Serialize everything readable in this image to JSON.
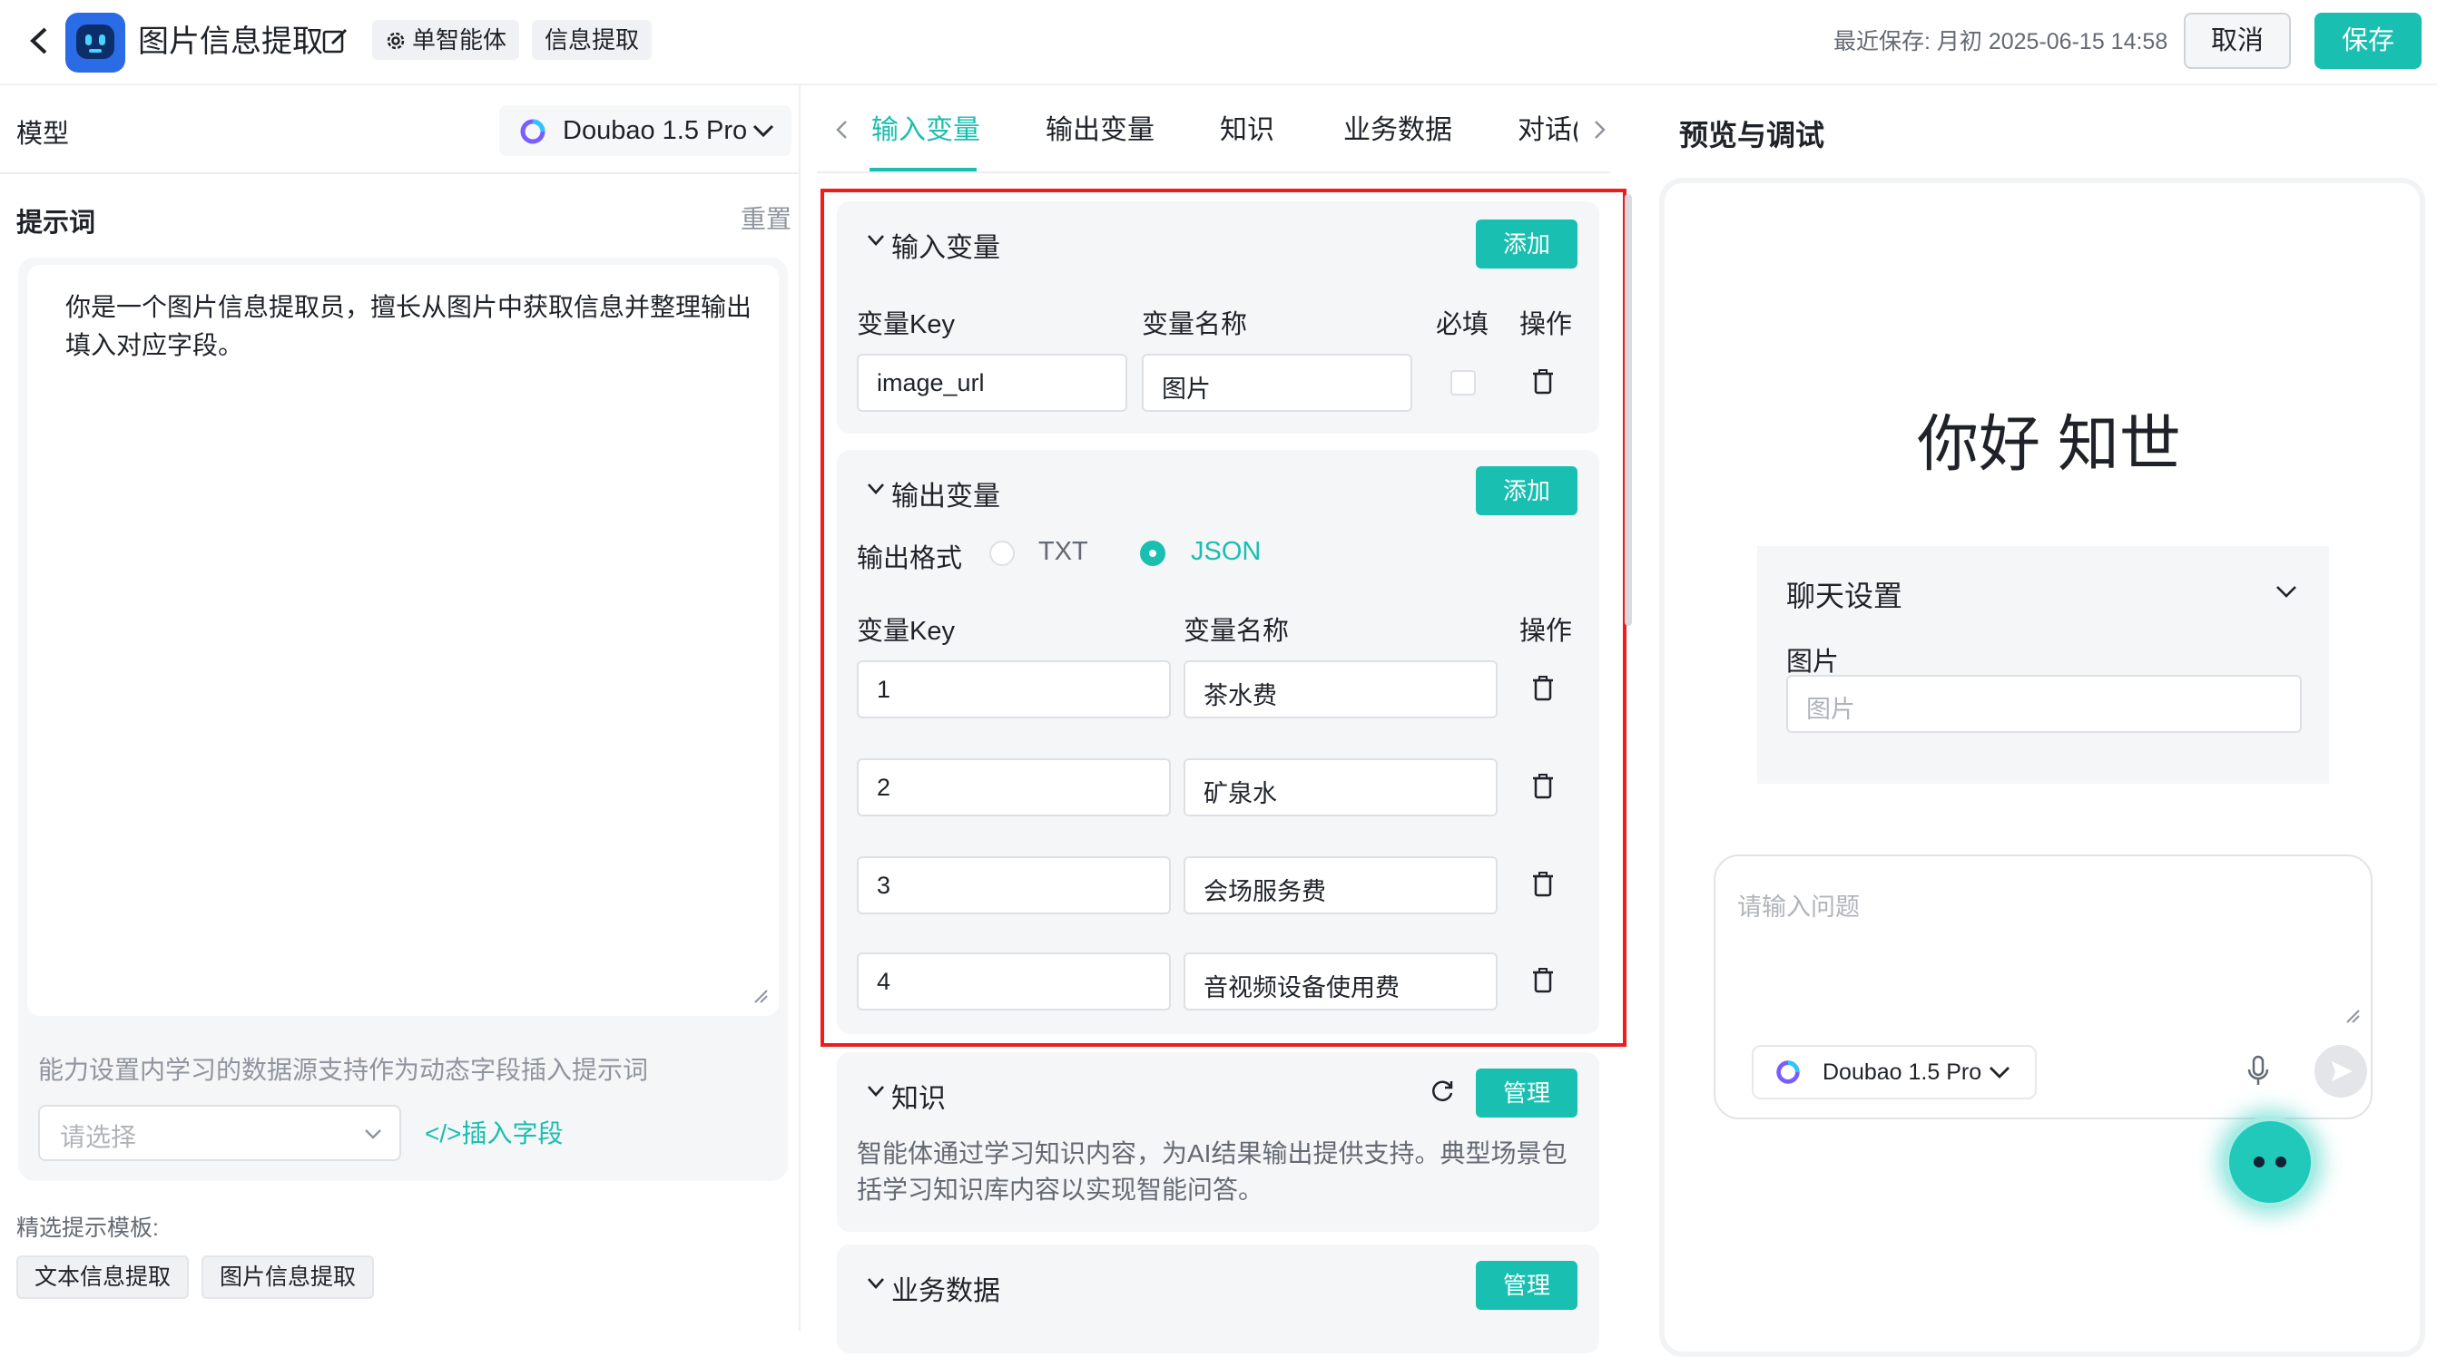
{
  "header": {
    "title": "图片信息提取",
    "tags": [
      "单智能体",
      "信息提取"
    ],
    "last_saved": "最近保存: 月初 2025-06-15 14:58",
    "cancel_label": "取消",
    "save_label": "保存"
  },
  "left": {
    "model_label": "模型",
    "model_name": "Doubao 1.5 Pro",
    "prompt_label": "提示词",
    "reset_label": "重置",
    "prompt_text": "你是一个图片信息提取员，擅长从图片中获取信息并整理输出填入对应字段。",
    "helper_text": "能力设置内学习的数据源支持作为动态字段插入提示词",
    "select_placeholder": "请选择",
    "insert_field_label": "</>插入字段",
    "template_label": "精选提示模板:",
    "templates": [
      "文本信息提取",
      "图片信息提取"
    ]
  },
  "tabs": [
    "输入变量",
    "输出变量",
    "知识",
    "业务数据",
    "对话("
  ],
  "input_vars": {
    "title": "输入变量",
    "add_label": "添加",
    "columns": [
      "变量Key",
      "变量名称",
      "必填",
      "操作"
    ],
    "rows": [
      {
        "key": "image_url",
        "name": "图片",
        "required": false
      }
    ]
  },
  "output_vars": {
    "title": "输出变量",
    "add_label": "添加",
    "format_label": "输出格式",
    "formats": [
      {
        "label": "TXT",
        "selected": false
      },
      {
        "label": "JSON",
        "selected": true
      }
    ],
    "columns": [
      "变量Key",
      "变量名称",
      "操作"
    ],
    "rows": [
      {
        "key": "1",
        "name": "茶水费"
      },
      {
        "key": "2",
        "name": "矿泉水"
      },
      {
        "key": "3",
        "name": "会场服务费"
      },
      {
        "key": "4",
        "name": "音视频设备使用费"
      }
    ]
  },
  "knowledge": {
    "title": "知识",
    "manage_label": "管理",
    "description": "智能体通过学习知识内容，为AI结果输出提供支持。典型场景包括学习知识库内容以实现智能问答。"
  },
  "business_data": {
    "title": "业务数据",
    "manage_label": "管理"
  },
  "preview": {
    "title": "预览与调试",
    "greeting": "你好 知世",
    "chat_settings_title": "聊天设置",
    "image_label": "图片",
    "image_placeholder": "图片",
    "question_placeholder": "请输入问题",
    "model_name": "Doubao 1.5 Pro"
  },
  "colors": {
    "accent": "#19bfb0",
    "highlight": "#ee1c1c"
  }
}
